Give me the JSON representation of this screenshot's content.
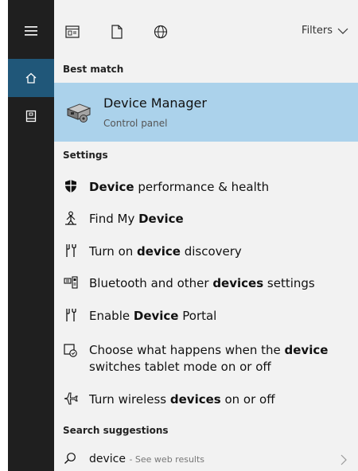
{
  "topbar": {
    "filters_label": "Filters"
  },
  "sections": {
    "best_match": "Best match",
    "settings": "Settings",
    "search_suggestions": "Search suggestions"
  },
  "best_match": {
    "title": "Device Manager",
    "subtitle": "Control panel"
  },
  "settings": [
    {
      "pre": "",
      "bold": "Device",
      "post": " performance & health",
      "icon": "shield-icon"
    },
    {
      "pre": "Find My ",
      "bold": "Device",
      "post": "",
      "icon": "person-location-icon"
    },
    {
      "pre": "Turn on ",
      "bold": "device",
      "post": " discovery",
      "icon": "device-discovery-icon"
    },
    {
      "pre": "Bluetooth and other ",
      "bold": "devices",
      "post": " settings",
      "icon": "keyboard-devices-icon"
    },
    {
      "pre": "Enable ",
      "bold": "Device",
      "post": " Portal",
      "icon": "developer-icon"
    },
    {
      "pre": "Choose what happens when the ",
      "bold": "device",
      "post": "",
      "line2": "switches tablet mode on or off",
      "icon": "tablet-mode-icon"
    },
    {
      "pre": "Turn wireless ",
      "bold": "devices",
      "post": " on or off",
      "icon": "airplane-icon"
    }
  ],
  "suggestion": {
    "query": "device",
    "hint": "- See web results"
  },
  "colors": {
    "rail": "#1f1f1f",
    "rail_active": "#205779",
    "panel": "#f2f2f2",
    "selection": "#abd2eb"
  }
}
